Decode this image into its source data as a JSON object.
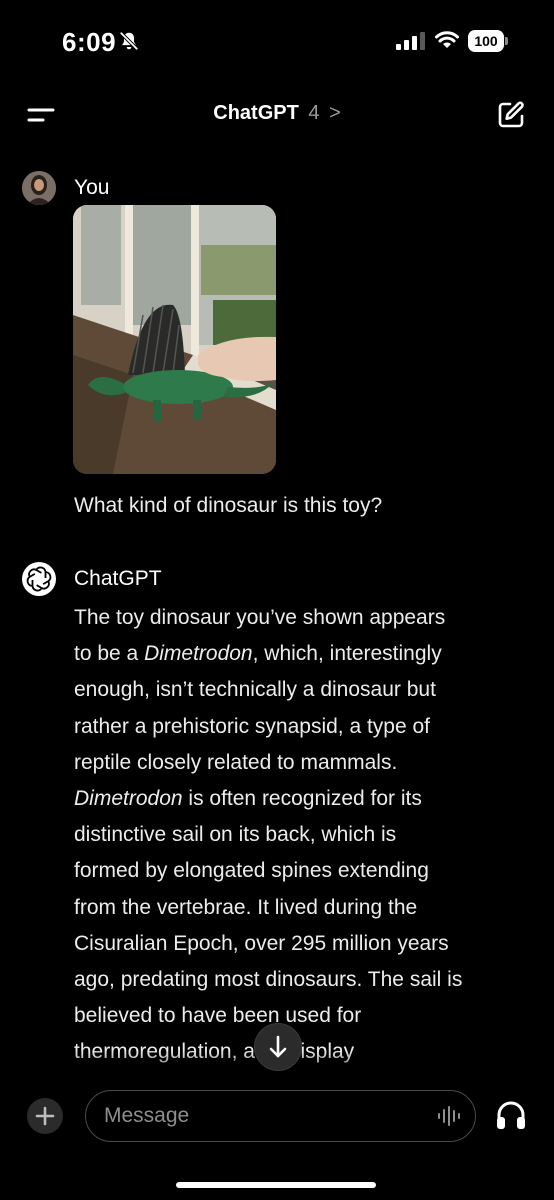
{
  "status_bar": {
    "time": "6:09",
    "battery": "100"
  },
  "header": {
    "title": "ChatGPT",
    "version": "4",
    "chevron": ">"
  },
  "icons": {
    "menu": "menu-icon",
    "compose": "compose-icon",
    "bell_muted": "bell-slash-icon",
    "signal": "signal-icon",
    "wifi": "wifi-icon",
    "battery": "battery-icon",
    "scroll_down": "arrow-down-icon",
    "plus": "plus-icon",
    "voice": "waveform-icon",
    "headphones": "headphones-icon",
    "openai_logo": "openai-logo-icon"
  },
  "conversation": {
    "user": {
      "name": "You",
      "message": "What kind of dinosaur is this toy?"
    },
    "assistant": {
      "name": "ChatGPT",
      "lines": [
        [
          "The toy dinosaur you’ve shown appears"
        ],
        [
          "to be a ",
          {
            "i": "Dimetrodon"
          },
          ", which, interestingly"
        ],
        [
          "enough, isn’t technically a dinosaur but"
        ],
        [
          "rather a prehistoric synapsid, a type of"
        ],
        [
          "reptile closely related to mammals."
        ],
        [
          {
            "i": "Dimetrodon"
          },
          " is often recognized for its"
        ],
        [
          "distinctive sail on its back, which is"
        ],
        [
          "formed by elongated spines extending"
        ],
        [
          "from the vertebrae. It lived during the"
        ],
        [
          "Cisuralian Epoch, over 295 million years"
        ],
        [
          "ago, predating most dinosaurs. The sail is"
        ],
        [
          "believed to have been used for"
        ],
        [
          "thermoregulation, as a display"
        ]
      ]
    }
  },
  "composer": {
    "placeholder": "Message"
  },
  "colors": {
    "background": "#000000",
    "text": "#ececec",
    "muted": "#8e8e8e",
    "button_bg": "#2b2b2b"
  }
}
